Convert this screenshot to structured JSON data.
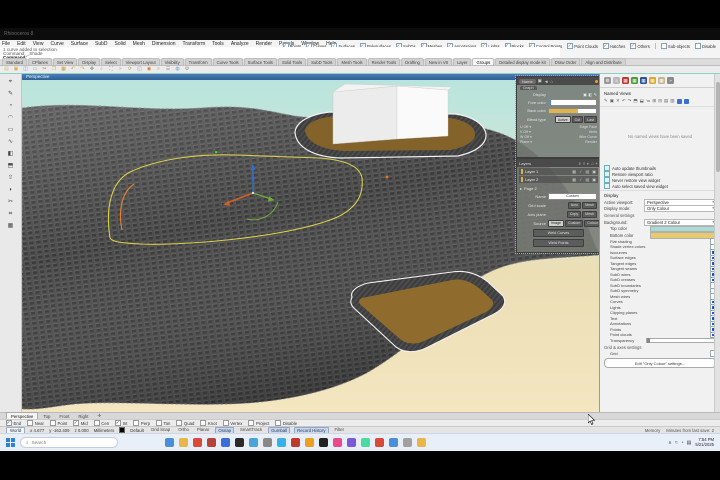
{
  "window": {
    "title": "Rhinoceros 8"
  },
  "menu": [
    "File",
    "Edit",
    "View",
    "Curve",
    "Surface",
    "SubD",
    "Solid",
    "Mesh",
    "Dimension",
    "Transform",
    "Tools",
    "Analyze",
    "Render",
    "Panels",
    "Window",
    "Help"
  ],
  "command": {
    "history": [
      "1 curve added to selection.",
      "Command: _Shade"
    ],
    "prompt": "Command:"
  },
  "selection_filter": {
    "items": [
      {
        "label": "Points",
        "checked": true
      },
      {
        "label": "Curves",
        "checked": true
      },
      {
        "label": "Surfaces",
        "checked": true
      },
      {
        "label": "Polysurfaces",
        "checked": true
      },
      {
        "label": "SubDs",
        "checked": true
      },
      {
        "label": "Meshes",
        "checked": true
      },
      {
        "label": "Annotations",
        "checked": true
      },
      {
        "label": "Lights",
        "checked": true
      },
      {
        "label": "Blocks",
        "checked": true
      },
      {
        "label": "Control Points",
        "checked": true
      },
      {
        "label": "Point Clouds",
        "checked": true
      },
      {
        "label": "Hatches",
        "checked": true
      },
      {
        "label": "Others",
        "checked": true
      }
    ],
    "extras": [
      {
        "label": "Sub-objects",
        "checked": false
      },
      {
        "label": "Disable",
        "checked": false
      }
    ]
  },
  "toolbar_tabs": {
    "items": [
      "Standard",
      "CPlanes",
      "Set View",
      "Display",
      "Select",
      "Viewport Layout",
      "Visibility",
      "Transform",
      "Curve Tools",
      "Surface Tools",
      "Solid Tools",
      "SubD Tools",
      "Mesh Tools",
      "Render Tools",
      "Drafting",
      "New in V8",
      "Layer",
      "Groups",
      "Detailed display mode kit",
      "Draw Order",
      "Align and Distribute"
    ],
    "selected": "Groups"
  },
  "toolbar_icons": [
    {
      "name": "new-file-icon",
      "glyph": "▤",
      "color": "#d9c27a"
    },
    {
      "name": "open-icon",
      "glyph": "▣",
      "color": "#d9b44a"
    },
    {
      "name": "save-icon",
      "glyph": "◫",
      "color": "#8aa0c0"
    },
    {
      "name": "print-icon",
      "glyph": "▭",
      "color": "#9a9a9a"
    },
    {
      "name": "cut-icon",
      "glyph": "✂",
      "color": "#b08040"
    },
    {
      "name": "copy-icon",
      "glyph": "❐",
      "color": "#d9b44a"
    },
    {
      "name": "paste-icon",
      "glyph": "▦",
      "color": "#c8a040"
    },
    {
      "name": "undo-icon",
      "glyph": "↶",
      "color": "#d9a040"
    },
    {
      "name": "redo-icon",
      "glyph": "↷",
      "color": "#d9a040"
    },
    {
      "name": "pan-icon",
      "glyph": "✥",
      "color": "#888888"
    },
    {
      "name": "zoom-icon",
      "glyph": "⌕",
      "color": "#b0b0b0"
    },
    {
      "name": "zoom-extents-icon",
      "glyph": "⛶",
      "color": "#909090"
    },
    {
      "name": "move-icon",
      "glyph": "➤",
      "color": "#c8c8c8"
    },
    {
      "name": "rotate-icon",
      "glyph": "⟳",
      "color": "#c0a050"
    },
    {
      "name": "scale-icon",
      "glyph": "◱",
      "color": "#a0a0a0"
    },
    {
      "name": "gumball-icon",
      "glyph": "◉",
      "color": "#d98030"
    },
    {
      "name": "layer-icon",
      "glyph": "≡",
      "color": "#b8b8b8"
    },
    {
      "name": "properties-icon",
      "glyph": "☰",
      "color": "#9a9a9a"
    },
    {
      "name": "render-icon",
      "glyph": "◍",
      "color": "#6a9ad9"
    },
    {
      "name": "options-icon",
      "glyph": "⚙",
      "color": "#909090"
    }
  ],
  "left_toolbar": [
    {
      "name": "pointer-tool-icon",
      "glyph": "⌖"
    },
    {
      "name": "polyline-tool-icon",
      "glyph": "✎"
    },
    {
      "name": "circle-tool-icon",
      "glyph": "◔"
    },
    {
      "name": "arc-tool-icon",
      "glyph": "◠"
    },
    {
      "name": "rectangle-tool-icon",
      "glyph": "▭"
    },
    {
      "name": "curve-tool-icon",
      "glyph": "∿"
    },
    {
      "name": "surface-tool-icon",
      "glyph": "◧"
    },
    {
      "name": "box-tool-icon",
      "glyph": "⬒"
    },
    {
      "name": "extrude-tool-icon",
      "glyph": "⇧"
    },
    {
      "name": "fillet-tool-icon",
      "glyph": "◗"
    },
    {
      "name": "trim-tool-icon",
      "glyph": "✂"
    },
    {
      "name": "join-tool-icon",
      "glyph": "⌗"
    },
    {
      "name": "mesh-tool-icon",
      "glyph": "▦"
    }
  ],
  "viewport": {
    "title": "Perspective",
    "colors": {
      "sky_top": "#b7e4dd",
      "sky_bottom": "#f3e6c0",
      "terrain": "#4a4a4a",
      "terrain_dark": "#3a3a3a",
      "pad": "#8f6c2e",
      "skirt": "#3d3d3d",
      "selected_curve": "#d8d04e",
      "gumball_x": "#d06028",
      "gumball_y": "#6fae3f",
      "gumball_z": "#2f6fd0"
    }
  },
  "floating_panels": {
    "panel_a": {
      "title": "Name",
      "header_icons": [
        "folder-icon",
        "pin-icon",
        "user-icon"
      ],
      "close_dot_color": "#e8a020",
      "tab": "Graph",
      "row_display": {
        "label": "Display"
      },
      "row_fore": {
        "label": "Fore color"
      },
      "row_back": {
        "label": "Back color",
        "fill": "#e0b44a"
      },
      "row_blend": {
        "label": "Blend type",
        "buttons": [
          "Active",
          "Cut",
          "Last"
        ],
        "selected": "Active"
      },
      "mini_left": [
        "U Off",
        "V Off",
        "W Off",
        "Plane"
      ],
      "mini_right": [
        "Edge Face",
        "Verts",
        "Wire Curve",
        "Render"
      ]
    },
    "panel_b": {
      "title": "Layers",
      "header_icons": [
        "search-icon",
        "circle-icon",
        "contrast-icon",
        "home-icon",
        "add-icon"
      ],
      "layers": [
        {
          "name": "Layer 1",
          "icons": [
            "▦",
            "✓",
            "▤",
            "▣"
          ]
        },
        {
          "name": "Layer 2",
          "icons": [
            "▦",
            "✓",
            "▤",
            "▣"
          ]
        }
      ],
      "section": "Page 2",
      "field_name": {
        "label": "Name",
        "value": "Custom"
      },
      "row_scale": {
        "label": "Grid scale",
        "buttons": [
          "Auto",
          "Mesh"
        ]
      },
      "row_plane": {
        "label": "Axis plane",
        "buttons": [
          "Copy",
          "Mesh"
        ]
      },
      "row_source": {
        "label": "Source",
        "buttons": [
          "Image",
          "Custom",
          "Colour",
          "Mesh"
        ],
        "selected": "Image"
      },
      "wide_buttons": [
        "Weld Curves",
        "Weld Points"
      ]
    }
  },
  "right_panel": {
    "tabs": [
      {
        "name": "properties-tab",
        "glyph": "⚙",
        "color": "#9a9a9a"
      },
      {
        "name": "layers-tab",
        "glyph": "≡",
        "color": "#b8b8b8"
      },
      {
        "name": "materials-tab",
        "glyph": "▦",
        "color": "#c0392b"
      },
      {
        "name": "ground-tab",
        "glyph": "▦",
        "color": "#4a9a3a"
      },
      {
        "name": "display-tab",
        "glyph": "▦",
        "color": "#2f4f8f"
      },
      {
        "name": "sun-tab",
        "glyph": "▦",
        "color": "#d9a82a"
      },
      {
        "name": "libraries-tab",
        "glyph": "▦",
        "color": "#c8b48a"
      },
      {
        "name": "more-tabs",
        "glyph": "»",
        "color": "#8a8a8a"
      }
    ],
    "named_views": {
      "title": "Named Views",
      "toolbar": [
        "✎",
        "▣",
        "✕",
        "↶",
        "↷",
        "⬒",
        "⬓",
        "≔",
        "⊞",
        "⊟",
        "▤",
        "▥"
      ],
      "empty_message": "No named views have been saved"
    },
    "options": [
      {
        "label": "Auto update thumbnails",
        "checked": true
      },
      {
        "label": "Restore viewport ratio",
        "checked": true
      },
      {
        "label": "Never restore view widget",
        "checked": true
      },
      {
        "label": "Auto select saved view widget",
        "checked": true
      }
    ],
    "display": {
      "title": "Display",
      "active_viewport_label": "Active viewport:",
      "active_viewport": "Perspective",
      "display_mode_label": "Display mode:",
      "display_mode": "Only Colour",
      "general_settings_label": "General settings",
      "background_label": "Background:",
      "background_value": "Gradient 2 Colour",
      "top_color_label": "Top color",
      "top_color": "#a9dcd5",
      "bottom_color_label": "Bottom color",
      "bottom_color": "#e9c96d",
      "rows": [
        {
          "label": "Flat shading",
          "on": false
        },
        {
          "label": "Shade vertex colors",
          "on": false
        },
        {
          "label": "Isocurves",
          "on": true
        },
        {
          "label": "Surface edges",
          "on": true
        },
        {
          "label": "Tangent edges",
          "on": true
        },
        {
          "label": "Tangent seams",
          "on": true
        },
        {
          "label": "SubD wires",
          "on": true
        },
        {
          "label": "SubD creases",
          "on": true
        },
        {
          "label": "SubD boundaries",
          "on": false
        },
        {
          "label": "SubD symmetry",
          "on": false
        },
        {
          "label": "Mesh wires",
          "on": false
        },
        {
          "label": "Curves",
          "on": true
        },
        {
          "label": "Lights",
          "on": true
        },
        {
          "label": "Clipping planes",
          "on": true
        },
        {
          "label": "Text",
          "on": true
        },
        {
          "label": "Annotations",
          "on": true
        },
        {
          "label": "Points",
          "on": true
        },
        {
          "label": "Point clouds",
          "on": true
        }
      ],
      "transparency_label": "Transparency",
      "grid_section_label": "Grid & axes settings",
      "grid_row": {
        "label": "Grid",
        "on": false
      },
      "edit_button": "Edit \"Only Colour\" settings..."
    }
  },
  "viewport_tabs": {
    "items": [
      "Perspective",
      "Top",
      "Front",
      "Right"
    ],
    "active": "Perspective",
    "add_label": "✛"
  },
  "osnap": {
    "items": [
      {
        "label": "End",
        "checked": true
      },
      {
        "label": "Near",
        "checked": false
      },
      {
        "label": "Point",
        "checked": false
      },
      {
        "label": "Mid",
        "checked": true
      },
      {
        "label": "Cen",
        "checked": false
      },
      {
        "label": "Int",
        "checked": true
      },
      {
        "label": "Perp",
        "checked": false
      },
      {
        "label": "Tan",
        "checked": false
      },
      {
        "label": "Quad",
        "checked": false
      },
      {
        "label": "Knot",
        "checked": false
      },
      {
        "label": "Vertex",
        "checked": false
      },
      {
        "label": "Project",
        "checked": false
      },
      {
        "label": "Disable",
        "checked": false
      }
    ]
  },
  "status_bar": {
    "cplane": "World",
    "x": "x 4.677",
    "y": "y -162.409",
    "z": "z 0.000",
    "units": "Millimeters",
    "layer": "Default",
    "layer_color": "#000000",
    "toggles": [
      {
        "label": "Grid Snap",
        "active": false
      },
      {
        "label": "Ortho",
        "active": false
      },
      {
        "label": "Planar",
        "active": false
      },
      {
        "label": "Osnap",
        "active": true
      },
      {
        "label": "SmartTrack",
        "active": false
      },
      {
        "label": "Gumball",
        "active": true
      },
      {
        "label": "Record History",
        "active": true
      },
      {
        "label": "Filter",
        "active": false
      }
    ],
    "memory": "Memory",
    "autosave": "Minutes from last save: 2"
  },
  "taskbar": {
    "search_placeholder": "Search",
    "icons": [
      "#4a90d9",
      "#e8b64a",
      "#d94a3a",
      "#b4443a",
      "#3a6fd9",
      "#2b2b2b",
      "#4aa3d9",
      "#888888",
      "#3ab0e8",
      "#c03a2b",
      "#e8a020",
      "#222222",
      "#e84a8a",
      "#7a5ad9",
      "#4ad9a0",
      "#d94a3a",
      "#4a90d9",
      "#a0a0a0",
      "#e8b64a"
    ],
    "tray_icons": [
      "∧",
      "≈",
      "◔",
      "▤"
    ],
    "clock_time": "7:54 PM",
    "clock_date": "5/21/2025"
  }
}
